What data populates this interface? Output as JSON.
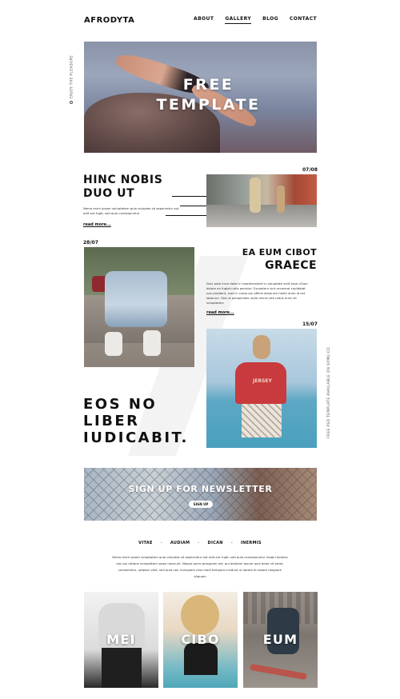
{
  "header": {
    "logo": "AFRODYTA",
    "nav": [
      {
        "label": "ABOUT",
        "active": false
      },
      {
        "label": "GALLERY",
        "active": true
      },
      {
        "label": "BLOG",
        "active": false
      },
      {
        "label": "CONTACT",
        "active": false
      }
    ]
  },
  "hero": {
    "line1": "FREE",
    "line2": "TEMPLATE"
  },
  "side": {
    "left": "ENJOY THE PLEASURE",
    "right": "FREE PSD TEMPLATE AVAILABLE ON SYMU.CO"
  },
  "article1": {
    "date": "07/08",
    "title_line1": "HINC NOBIS",
    "title_line2": "DUO UT",
    "text": "Nemo enim ipsam voluptatem quia voluptas sit aspernatur aut odit aut fugit, sed quia consequuntur",
    "read_more": "read more..."
  },
  "article2": {
    "date": "28/07",
    "title_line1": "EA EUM CIBOT",
    "title_line2": "GRAECE",
    "text": "Duis aute irure dolor in reprehenderit in voluptate velit esse cillum dolore eu fugiat nulla pariatur. Excepteur sint occaecat cupidatat non proident, sunt in culpa qui officia deserunt mollit anim id est laborum. Sed ut perspiciatis unde omnis iste natus error sit voluptatem",
    "read_more": "read more..."
  },
  "article3": {
    "date": "15/07",
    "shirt_text": "JERSEY"
  },
  "quote": {
    "line1": "EOS NO",
    "line2": "LIBER",
    "line3": "IUDICABIT."
  },
  "newsletter": {
    "title": "SIGN UP FOR NEWSLETTER",
    "button": "SIGN UP"
  },
  "tags": [
    "VITAE",
    "AUDIAM",
    "DICAN",
    "INERMIS"
  ],
  "tag_separator": "-",
  "paragraph": "Nemo enim ipsam voluptatem quia voluptas sit aspernatur aut odit aut fugit, sed quia consequuntur magni dolores eos qui ratione voluptatem sequi nesciunt. Neque porro quisquam est, qui dolorem ipsum quia dolor sit amet, consectetur, adipisci velit, sed quia non numquam eius modi tempora incidunt ut labore et dolore magnam aliquam",
  "cards": [
    {
      "label": "MEI"
    },
    {
      "label": "CIBO"
    },
    {
      "label": "EUM"
    }
  ]
}
